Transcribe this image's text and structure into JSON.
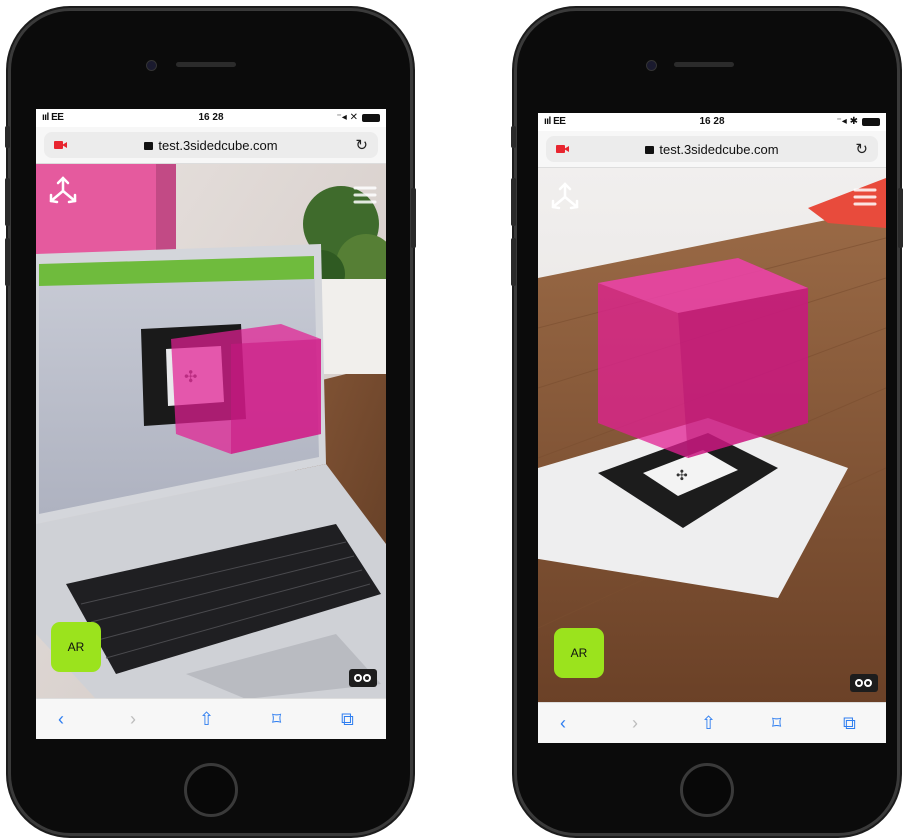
{
  "phones": [
    {
      "status": {
        "signal": "ııl EE ",
        "time": "16 28",
        "right": "⁻◂ ✕"
      },
      "url_bar": {
        "url": "test.3sidedcube.com",
        "reload": "↻"
      },
      "ar_button": "AR",
      "toolbar": {
        "back": "‹",
        "forward": "›",
        "share": "⇧",
        "bookmarks": "⌑",
        "tabs": "⧉"
      }
    },
    {
      "status": {
        "signal": "ııl EE ",
        "time": "16 28",
        "right": "⁻◂ ✱"
      },
      "url_bar": {
        "url": "test.3sidedcube.com",
        "reload": "↻"
      },
      "ar_button": "AR",
      "toolbar": {
        "back": "‹",
        "forward": "›",
        "share": "⇧",
        "bookmarks": "⌑",
        "tabs": "⧉"
      }
    }
  ],
  "colors": {
    "accent_pink": "#e21f93",
    "ar_green": "#9be31d",
    "ios_blue": "#2f7ef0"
  },
  "icons": [
    "move-3d-icon",
    "hamburger-menu-icon",
    "vr-goggles-icon",
    "camera-recording-icon",
    "lock-icon",
    "reload-icon"
  ]
}
